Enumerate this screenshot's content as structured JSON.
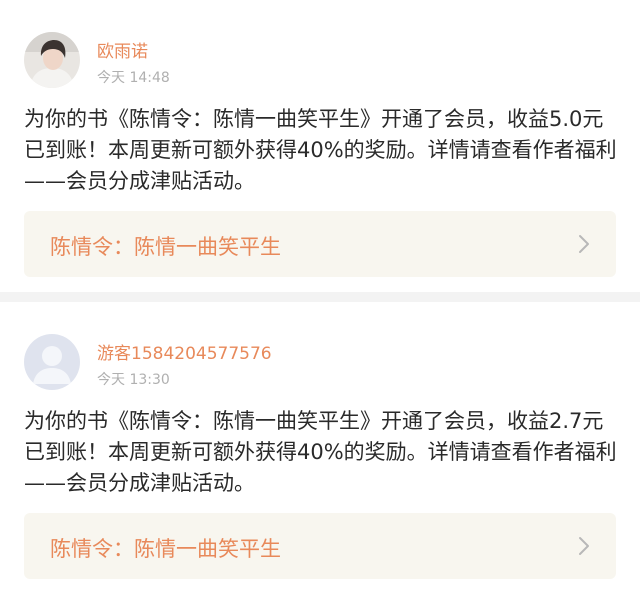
{
  "messages": [
    {
      "username": "欧雨诺",
      "time": "今天 14:48",
      "text": "为你的书《陈情令：陈情一曲笑平生》开通了会员，收益5.0元已到账！本周更新可额外获得40%的奖励。详情请查看作者福利——会员分成津贴活动。",
      "book_title": "陈情令：陈情一曲笑平生",
      "avatar_type": "photo",
      "link_icon": "chevron-right-icon"
    },
    {
      "username": "游客1584204577576",
      "time": "今天 13:30",
      "text": "为你的书《陈情令：陈情一曲笑平生》开通了会员，收益2.7元已到账！本周更新可额外获得40%的奖励。详情请查看作者福利——会员分成津贴活动。",
      "book_title": "陈情令：陈情一曲笑平生",
      "avatar_type": "default",
      "link_icon": "chevron-right-icon"
    }
  ],
  "colors": {
    "accent": "#e8895a",
    "text": "#2a2a2a",
    "muted": "#b0b0b0",
    "link_bg": "#f8f6ef",
    "separator": "#f3f3f3"
  }
}
